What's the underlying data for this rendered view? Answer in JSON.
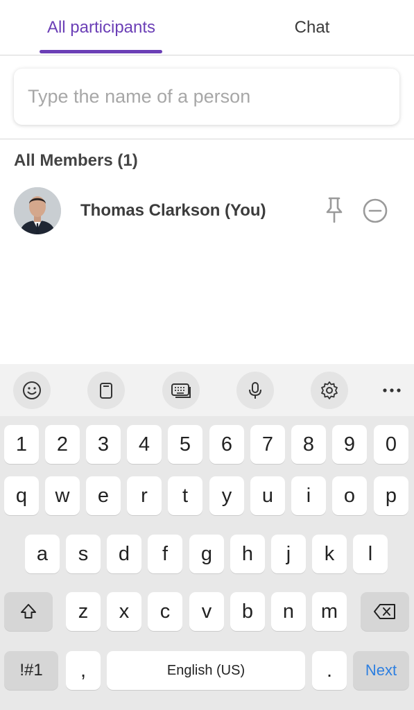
{
  "tabs": {
    "participants": "All participants",
    "chat": "Chat"
  },
  "search": {
    "placeholder": "Type the name of a person",
    "value": ""
  },
  "members": {
    "header": "All Members (1)",
    "list": [
      {
        "name": "Thomas Clarkson (You)",
        "avatar": "person-photo"
      }
    ]
  },
  "colors": {
    "accent": "#6b3fb6",
    "next_key": "#2d7fe0"
  },
  "keyboard": {
    "toolbar": [
      "emoji-icon",
      "clipboard-icon",
      "keyboard-mode-icon",
      "microphone-icon",
      "settings-icon",
      "more-icon"
    ],
    "row_numbers": [
      "1",
      "2",
      "3",
      "4",
      "5",
      "6",
      "7",
      "8",
      "9",
      "0"
    ],
    "row_top": [
      "q",
      "w",
      "e",
      "r",
      "t",
      "y",
      "u",
      "i",
      "o",
      "p"
    ],
    "row_middle": [
      "a",
      "s",
      "d",
      "f",
      "g",
      "h",
      "j",
      "k",
      "l"
    ],
    "row_bottom": [
      "z",
      "x",
      "c",
      "v",
      "b",
      "n",
      "m"
    ],
    "symbols_label": "!#1",
    "comma_label": ",",
    "space_label": "English (US)",
    "period_label": ".",
    "next_label": "Next"
  }
}
